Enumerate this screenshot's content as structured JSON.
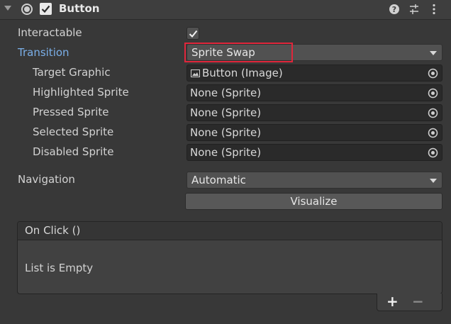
{
  "header": {
    "title": "Button",
    "enabled": true,
    "icons": [
      "foldout-arrow-icon",
      "component-icon",
      "help-icon",
      "preset-icon",
      "context-menu-icon"
    ]
  },
  "fields": {
    "interactable": {
      "label": "Interactable",
      "checked": true
    },
    "transition": {
      "label": "Transition",
      "value": "Sprite Swap"
    },
    "target_graphic": {
      "label": "Target Graphic",
      "value": "Button (Image)"
    },
    "highlighted_sprite": {
      "label": "Highlighted Sprite",
      "value": "None (Sprite)"
    },
    "pressed_sprite": {
      "label": "Pressed Sprite",
      "value": "None (Sprite)"
    },
    "selected_sprite": {
      "label": "Selected Sprite",
      "value": "None (Sprite)"
    },
    "disabled_sprite": {
      "label": "Disabled Sprite",
      "value": "None (Sprite)"
    },
    "navigation": {
      "label": "Navigation",
      "value": "Automatic"
    },
    "visualize_label": "Visualize"
  },
  "on_click": {
    "title": "On Click ()",
    "empty_text": "List is Empty",
    "add_label": "+",
    "remove_label": "−"
  },
  "colors": {
    "highlight_border": "#e0263b",
    "transition_label": "#7bafe8",
    "panel_bg": "#383838"
  }
}
